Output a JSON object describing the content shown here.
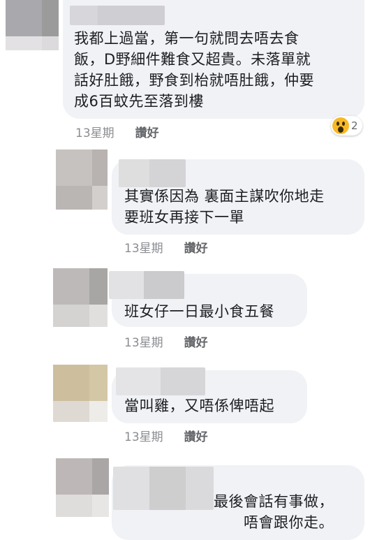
{
  "comments": [
    {
      "text": "我都上過當，第一句就問去唔去食\n飯，D野細件難食又超貴。未落單就\n話好肚餓，野食到枱就唔肚餓，仲要\n成6百蚊先至落到樓",
      "time": "13星期",
      "like": "讚好",
      "reaction": {
        "icon": "wow-emoji-icon",
        "count": "2"
      }
    },
    {
      "text": "其實係因為 裏面主謀吹你地走\n要班女再接下一單",
      "time": "13星期",
      "like": "讚好"
    },
    {
      "text": "班女仔一日最小食五餐",
      "time": "13星期",
      "like": "讚好"
    },
    {
      "text": "當叫雞，又唔係俾唔起",
      "time": "13星期",
      "like": "讚好"
    },
    {
      "text": "最後會話有事做，\n唔會跟你走。"
    }
  ],
  "colors": {
    "bubble": "#f0f2f5",
    "meta_text": "#8a8d91",
    "like_text": "#65676b",
    "wow_yellow": "#f7b928"
  }
}
